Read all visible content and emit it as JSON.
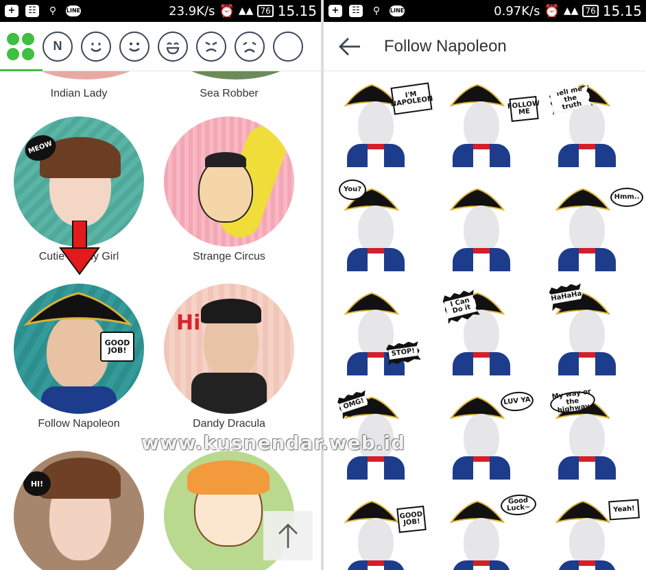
{
  "left": {
    "status": {
      "speed": "23.9K/s",
      "battery": "76",
      "time": "15.15",
      "line_label": "LINE"
    },
    "tabs": {
      "n_label": "N"
    },
    "top_labels": [
      "Indian Lady",
      "Sea Robber"
    ],
    "items": [
      {
        "label": "Cutie Bunny Girl",
        "bubble": "MEOW"
      },
      {
        "label": "Strange Circus"
      },
      {
        "label": "Follow Napoleon",
        "bubble": "GOOD JOB!"
      },
      {
        "label": "Dandy Dracula",
        "bubble": "Hi"
      },
      {
        "bubble": "HI!"
      },
      {}
    ],
    "watermark": "www.kusnendar.web.id"
  },
  "right": {
    "status": {
      "speed": "0.97K/s",
      "battery": "76",
      "time": "15.15",
      "line_label": "LINE"
    },
    "title": "Follow Napoleon",
    "stickers": [
      {
        "text": "I'M NAPOLEON"
      },
      {
        "text": "FOLLOW ME"
      },
      {
        "text": "Tell me the truth"
      },
      {
        "text": "You?"
      },
      {
        "text": ""
      },
      {
        "text": "Hmm.."
      },
      {
        "text": "STOP!"
      },
      {
        "text": "I Can Do it"
      },
      {
        "text": "HaHaHa"
      },
      {
        "text": "OMG!"
      },
      {
        "text": "LUV YA"
      },
      {
        "text": "My way or the highway"
      },
      {
        "text": "GOOD JOB!"
      },
      {
        "text": "Good Luck~"
      },
      {
        "text": "Yeah!"
      }
    ]
  },
  "colors": {
    "accent": "#3ebf41",
    "icon": "#3c4556",
    "arrow": "#e3191b"
  }
}
